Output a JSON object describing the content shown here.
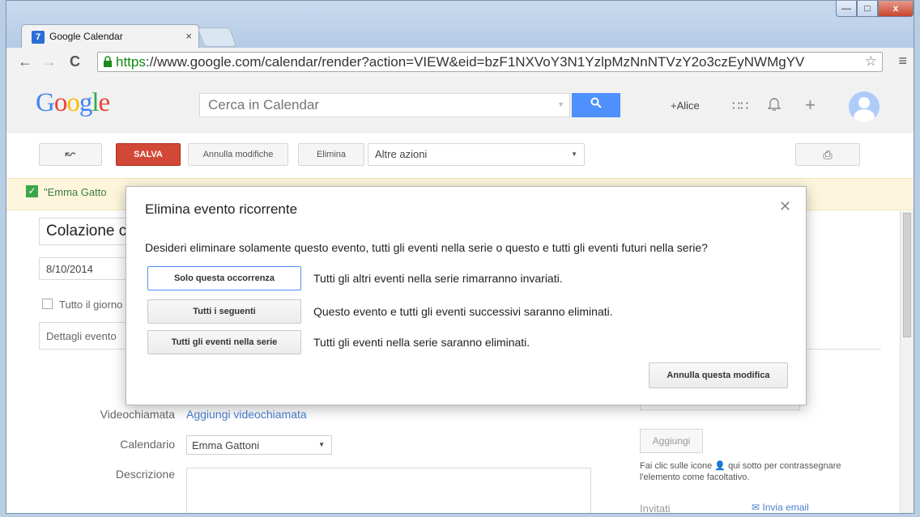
{
  "browser": {
    "tab_icon_text": "7",
    "tab_title": "Google Calendar",
    "tab_close": "×",
    "url_scheme": "https",
    "url_rest": "://www.google.com/calendar/render?action=VIEW&eid=bzF1NXVoY3N1YzlpMzNnNTVzY2o3czEyNWMgYV"
  },
  "header": {
    "logo": [
      "G",
      "o",
      "o",
      "g",
      "l",
      "e"
    ],
    "logo_colors": [
      "#4285f4",
      "#ea4335",
      "#fbbc05",
      "#4285f4",
      "#34a853",
      "#ea4335"
    ],
    "search_placeholder": "Cerca in Calendar",
    "user": "+Alice"
  },
  "actions": {
    "save": "SALVA",
    "discard": "Annulla modifiche",
    "delete": "Elimina",
    "more": "Altre azioni"
  },
  "notice": "\"Emma Gatto",
  "event": {
    "title": "Colazione c",
    "date": "8/10/2014",
    "all_day": "Tutto il giorno",
    "tab": "Dettagli evento"
  },
  "form": {
    "video_label": "Videochiamata",
    "video_link": "Aggiungi videochiamata",
    "calendar_label": "Calendario",
    "calendar_value": "Emma Gattoni",
    "description_label": "Descrizione",
    "add_guest": "Aggiungi",
    "hint": "Fai clic sulle icone 👤 qui sotto per contrassegnare l'elemento come facoltativo.",
    "guests": "Invitati",
    "send_email": "Invia email"
  },
  "dialog": {
    "title": "Elimina evento ricorrente",
    "question": "Desideri eliminare solamente questo evento, tutti gli eventi nella serie o questo e tutti gli eventi futuri nella serie?",
    "options": [
      {
        "button": "Solo questa occorrenza",
        "text": "Tutti gli altri eventi nella serie rimarranno invariati."
      },
      {
        "button": "Tutti i seguenti",
        "text": "Questo evento e tutti gli eventi successivi saranno eliminati."
      },
      {
        "button": "Tutti gli eventi nella serie",
        "text": "Tutti gli eventi nella serie saranno eliminati."
      }
    ],
    "cancel": "Annulla questa modifica"
  }
}
